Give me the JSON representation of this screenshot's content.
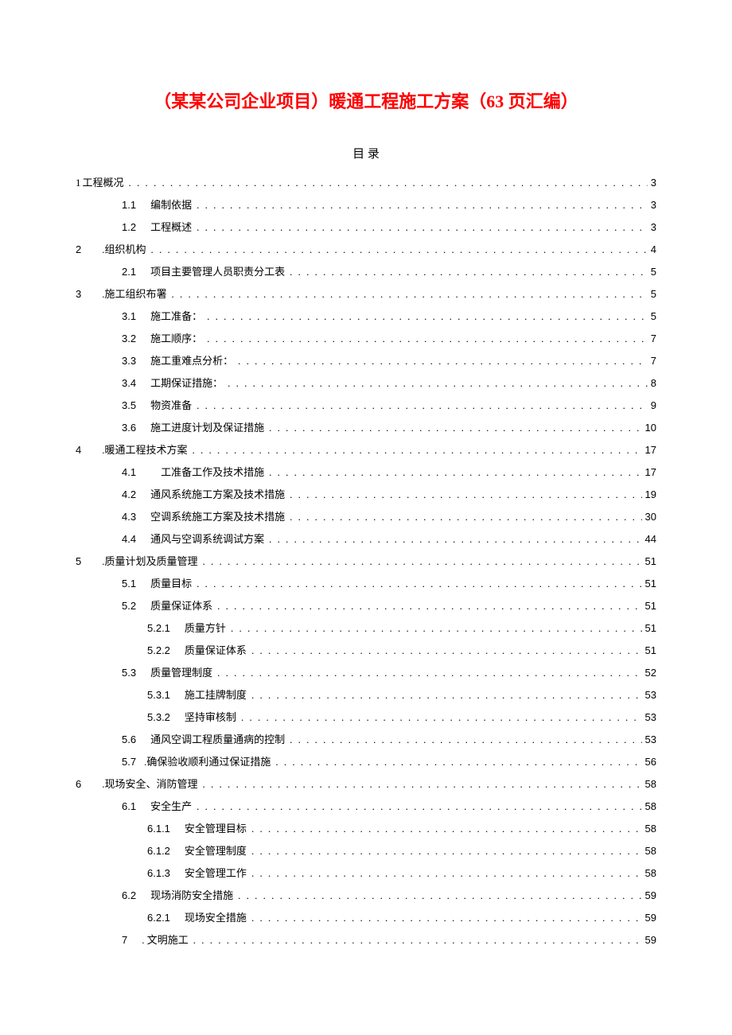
{
  "title": "（某某公司企业项目）暖通工程施工方案（63 页汇编）",
  "subtitle": "目 录",
  "toc": [
    {
      "level": "lvl1",
      "num": "1",
      "numClass": "toc-num-cjk",
      "label": "工程概况",
      "page": "3",
      "nospace": true
    },
    {
      "level": "lvl2",
      "num": "1.1",
      "label": "编制依据",
      "page": "3"
    },
    {
      "level": "lvl2",
      "num": "1.2",
      "label": "工程概述",
      "page": "3"
    },
    {
      "level": "lvl1-alt",
      "num": "2",
      "label": ".组织机构",
      "page": "4"
    },
    {
      "level": "lvl2",
      "num": "2.1",
      "label": "项目主要管理人员职责分工表",
      "page": "5"
    },
    {
      "level": "lvl1-alt",
      "num": "3",
      "label": ".施工组织布署",
      "page": "5"
    },
    {
      "level": "lvl2",
      "num": "3.1",
      "label": "施工准备：",
      "page": "5"
    },
    {
      "level": "lvl2",
      "num": "3.2",
      "label": "施工顺序：",
      "page": "7"
    },
    {
      "level": "lvl2",
      "num": "3.3",
      "label": "施工重难点分析：",
      "page": "7"
    },
    {
      "level": "lvl2",
      "num": "3.4",
      "label": "工期保证措施：",
      "page": "8"
    },
    {
      "level": "lvl2",
      "num": "3.5",
      "label": "物资准备",
      "page": "9"
    },
    {
      "level": "lvl2",
      "num": "3.6",
      "label": "施工进度计划及保证措施",
      "page": "10"
    },
    {
      "level": "lvl1-alt",
      "num": "4",
      "label": ".暖通工程技术方案",
      "page": "17"
    },
    {
      "level": "lvl2",
      "num": "4.1",
      "label": "　工准备工作及技术措施",
      "page": "17"
    },
    {
      "level": "lvl2",
      "num": "4.2",
      "label": "通风系统施工方案及技术措施",
      "page": "19"
    },
    {
      "level": "lvl2",
      "num": "4.3",
      "label": "空调系统施工方案及技术措施",
      "page": "30"
    },
    {
      "level": "lvl2",
      "num": "4.4",
      "label": "通风与空调系统调试方案",
      "page": "44"
    },
    {
      "level": "lvl1-alt",
      "num": "5",
      "label": ".质量计划及质量管理",
      "page": "51"
    },
    {
      "level": "lvl2",
      "num": "5.1",
      "label": "质量目标",
      "page": "51"
    },
    {
      "level": "lvl2",
      "num": "5.2",
      "label": "质量保证体系",
      "page": "51"
    },
    {
      "level": "lvl3",
      "num": "5.2.1",
      "label": "质量方针",
      "page": "51"
    },
    {
      "level": "lvl3",
      "num": "5.2.2",
      "label": "质量保证体系",
      "page": "51"
    },
    {
      "level": "lvl2",
      "num": "5.3",
      "label": "质量管理制度",
      "page": "52"
    },
    {
      "level": "lvl3",
      "num": "5.3.1",
      "label": "施工挂牌制度",
      "page": "53"
    },
    {
      "level": "lvl3",
      "num": "5.3.2",
      "label": "坚持审核制",
      "page": "53"
    },
    {
      "level": "lvl2",
      "num": "5.6",
      "label": "通风空调工程质量通病的控制",
      "page": "53"
    },
    {
      "level": "lvl2-alt",
      "num": "5.7",
      "label": ".确保验收顺利通过保证措施",
      "page": "56"
    },
    {
      "level": "lvl1-alt",
      "num": "6",
      "label": ".现场安全、消防管理",
      "page": "58"
    },
    {
      "level": "lvl2",
      "num": "6.1",
      "label": "安全生产",
      "page": "58"
    },
    {
      "level": "lvl3",
      "num": "6.1.1",
      "label": "安全管理目标",
      "page": "58"
    },
    {
      "level": "lvl3",
      "num": "6.1.2",
      "label": "安全管理制度",
      "page": "58"
    },
    {
      "level": "lvl3",
      "num": "6.1.3",
      "label": "安全管理工作",
      "page": "58"
    },
    {
      "level": "lvl2",
      "num": "6.2",
      "label": "现场消防安全措施",
      "page": "59"
    },
    {
      "level": "lvl3",
      "num": "6.2.1",
      "label": "现场安全措施",
      "page": "59"
    },
    {
      "level": "lvl2",
      "num": "7",
      "label": ". 文明施工",
      "page": "59"
    }
  ]
}
